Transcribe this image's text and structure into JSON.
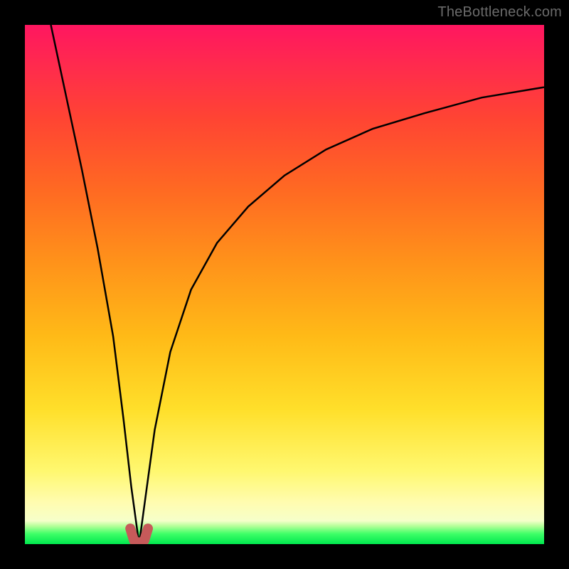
{
  "watermark": "TheBottleneck.com",
  "chart_data": {
    "type": "line",
    "title": "",
    "xlabel": "",
    "ylabel": "",
    "xlim": [
      0,
      100
    ],
    "ylim": [
      0,
      100
    ],
    "grid": false,
    "legend": false,
    "background_gradient": {
      "stops": [
        {
          "pos": 0.0,
          "color": "#ff1660"
        },
        {
          "pos": 0.08,
          "color": "#ff2b4d"
        },
        {
          "pos": 0.18,
          "color": "#ff4433"
        },
        {
          "pos": 0.32,
          "color": "#ff6a22"
        },
        {
          "pos": 0.46,
          "color": "#ff931a"
        },
        {
          "pos": 0.6,
          "color": "#ffba17"
        },
        {
          "pos": 0.74,
          "color": "#ffdf2a"
        },
        {
          "pos": 0.86,
          "color": "#fff870"
        },
        {
          "pos": 0.92,
          "color": "#fffcb0"
        },
        {
          "pos": 0.955,
          "color": "#f6ffca"
        },
        {
          "pos": 0.965,
          "color": "#b6ff9a"
        },
        {
          "pos": 0.98,
          "color": "#3fff68"
        },
        {
          "pos": 1.0,
          "color": "#00e84e"
        }
      ]
    },
    "series": [
      {
        "name": "bottleneck-curve",
        "stroke": "#000000",
        "stroke_width": 2.5,
        "comment": "V-shaped curve; minimum near x≈22 at y≈0, left branch steep, right branch asymptotic toward y≈88",
        "x": [
          5,
          8,
          11,
          14,
          17,
          19,
          20.5,
          22,
          23.5,
          25,
          28,
          32,
          37,
          43,
          50,
          58,
          67,
          77,
          88,
          100
        ],
        "y": [
          100,
          86,
          72,
          57,
          40,
          24,
          11,
          0,
          11,
          22,
          37,
          49,
          58,
          65,
          71,
          76,
          80,
          83,
          86,
          88
        ]
      },
      {
        "name": "minimum-marker",
        "stroke": "#c65a5a",
        "stroke_width": 14,
        "linecap": "round",
        "comment": "small rounded U highlighting the curve minimum",
        "x": [
          20.3,
          21.0,
          22.0,
          23.0,
          23.7
        ],
        "y": [
          3.0,
          0.7,
          0.2,
          0.7,
          3.0
        ]
      }
    ]
  }
}
